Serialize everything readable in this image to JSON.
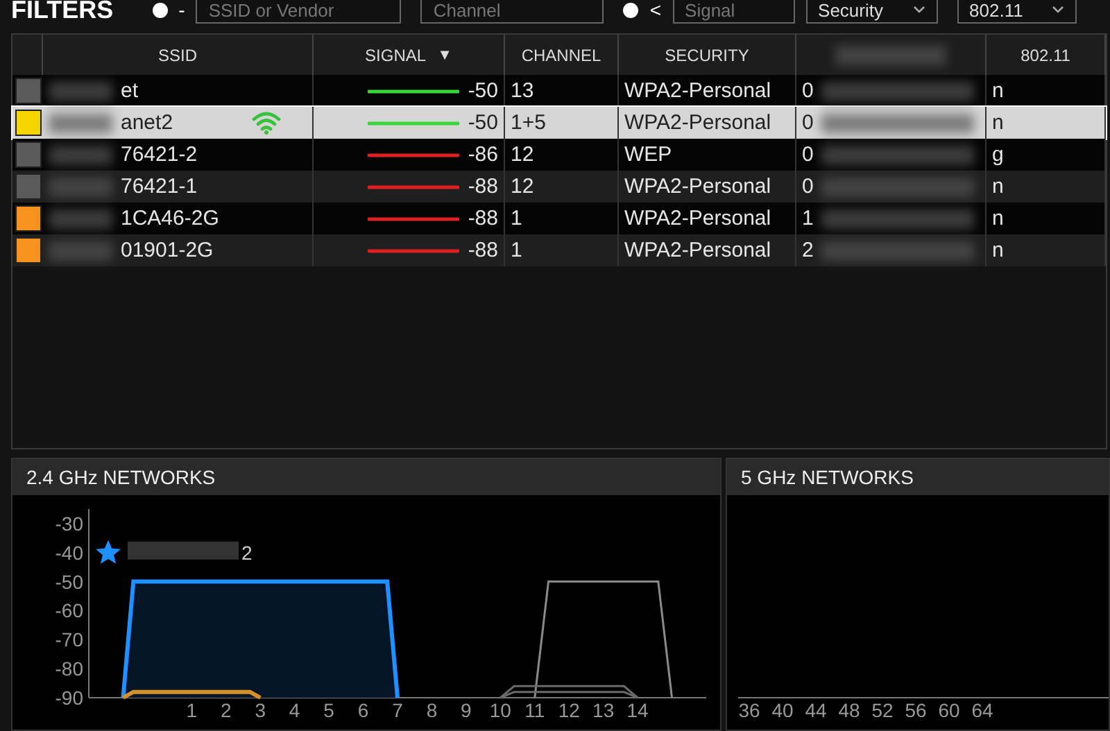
{
  "filters": {
    "title": "FILTERS",
    "ssid_radio": {
      "checked": true
    },
    "ssid_prefix": "-",
    "ssid": {
      "placeholder": "SSID or Vendor"
    },
    "channel": {
      "placeholder": "Channel"
    },
    "signal_radio": {
      "checked": true
    },
    "signal_prefix": "<",
    "signal": {
      "placeholder": "Signal"
    },
    "security": "Security",
    "standard": "802.11"
  },
  "table": {
    "columns": [
      "SSID",
      "SIGNAL",
      "CHANNEL",
      "SECURITY",
      "802.11"
    ],
    "sort_indicator": "▼",
    "rows": [
      {
        "color": "#5a5a5a",
        "ssid": "et",
        "kind": "strong",
        "signal": "-50",
        "channel": "13",
        "security": "WPA2-Personal",
        "column_5": "0",
        "standard": "n",
        "selected": false,
        "connected": false
      },
      {
        "color": "#f5d400",
        "ssid": "anet2",
        "kind": "strong",
        "signal": "-50",
        "channel": "1+5",
        "security": "WPA2-Personal",
        "column_5": "0",
        "standard": "n",
        "selected": true,
        "connected": true
      },
      {
        "color": "#5a5a5a",
        "ssid": "76421-2",
        "kind": "weak",
        "signal": "-86",
        "channel": "12",
        "security": "WEP",
        "column_5": "0",
        "standard": "g",
        "selected": false,
        "connected": false
      },
      {
        "color": "#5a5a5a",
        "ssid": "76421-1",
        "kind": "weak",
        "signal": "-88",
        "channel": "12",
        "security": "WPA2-Personal",
        "column_5": "0",
        "standard": "n",
        "selected": false,
        "connected": false
      },
      {
        "color": "#f7931e",
        "ssid": "1CA46-2G",
        "kind": "weak",
        "signal": "-88",
        "channel": "1",
        "security": "WPA2-Personal",
        "column_5": "1",
        "standard": "n",
        "selected": false,
        "connected": false
      },
      {
        "color": "#f7931e",
        "ssid": "01901-2G",
        "kind": "weak",
        "signal": "-88",
        "channel": "1",
        "security": "WPA2-Personal",
        "column_5": "2",
        "standard": "n",
        "selected": false,
        "connected": false
      }
    ]
  },
  "panels": [
    {
      "title": "2.4 GHz NETWORKS",
      "highlight_label": "2",
      "chart_data": {
        "type": "line",
        "x": [
          -1,
          -0.7,
          2.7,
          3,
          6.7,
          7,
          10,
          10.4,
          11,
          11.4,
          13.6,
          14,
          14.6,
          15
        ],
        "ylim": [
          -90,
          -25
        ],
        "xlim": [
          -2,
          16
        ],
        "yticks": [
          -30,
          -40,
          -50,
          -60,
          -70,
          -80,
          -90
        ],
        "xticks": [
          1,
          2,
          3,
          4,
          5,
          6,
          7,
          8,
          9,
          10,
          11,
          12,
          13,
          14
        ],
        "series": [
          {
            "color": "#1e90ff",
            "values": [
              -90,
              -50,
              -50,
              -50,
              -50,
              -90,
              null,
              null,
              null,
              null,
              null,
              null,
              null,
              null
            ]
          },
          {
            "color": "#d4902a",
            "values": [
              -90,
              -88,
              -88,
              -90,
              null,
              null,
              null,
              null,
              null,
              null,
              null,
              null,
              null,
              null
            ]
          },
          {
            "color": "#8a8a8a",
            "values": [
              null,
              null,
              null,
              null,
              null,
              null,
              null,
              null,
              -90,
              -50,
              -50,
              -50,
              -50,
              -90
            ]
          },
          {
            "color": "#6a6a6a",
            "values": [
              null,
              null,
              null,
              null,
              null,
              null,
              -90,
              -86,
              -86,
              -86,
              -86,
              -90,
              null,
              null
            ]
          },
          {
            "color": "#6a6a6a",
            "values": [
              null,
              null,
              null,
              null,
              null,
              null,
              -90,
              -88,
              -88,
              -88,
              -88,
              -90,
              null,
              null
            ]
          }
        ]
      }
    },
    {
      "title": "5 GHz NETWORKS",
      "channel_labels": [
        "36",
        "40",
        "44",
        "48",
        "52",
        "56",
        "60",
        "64"
      ]
    }
  ]
}
